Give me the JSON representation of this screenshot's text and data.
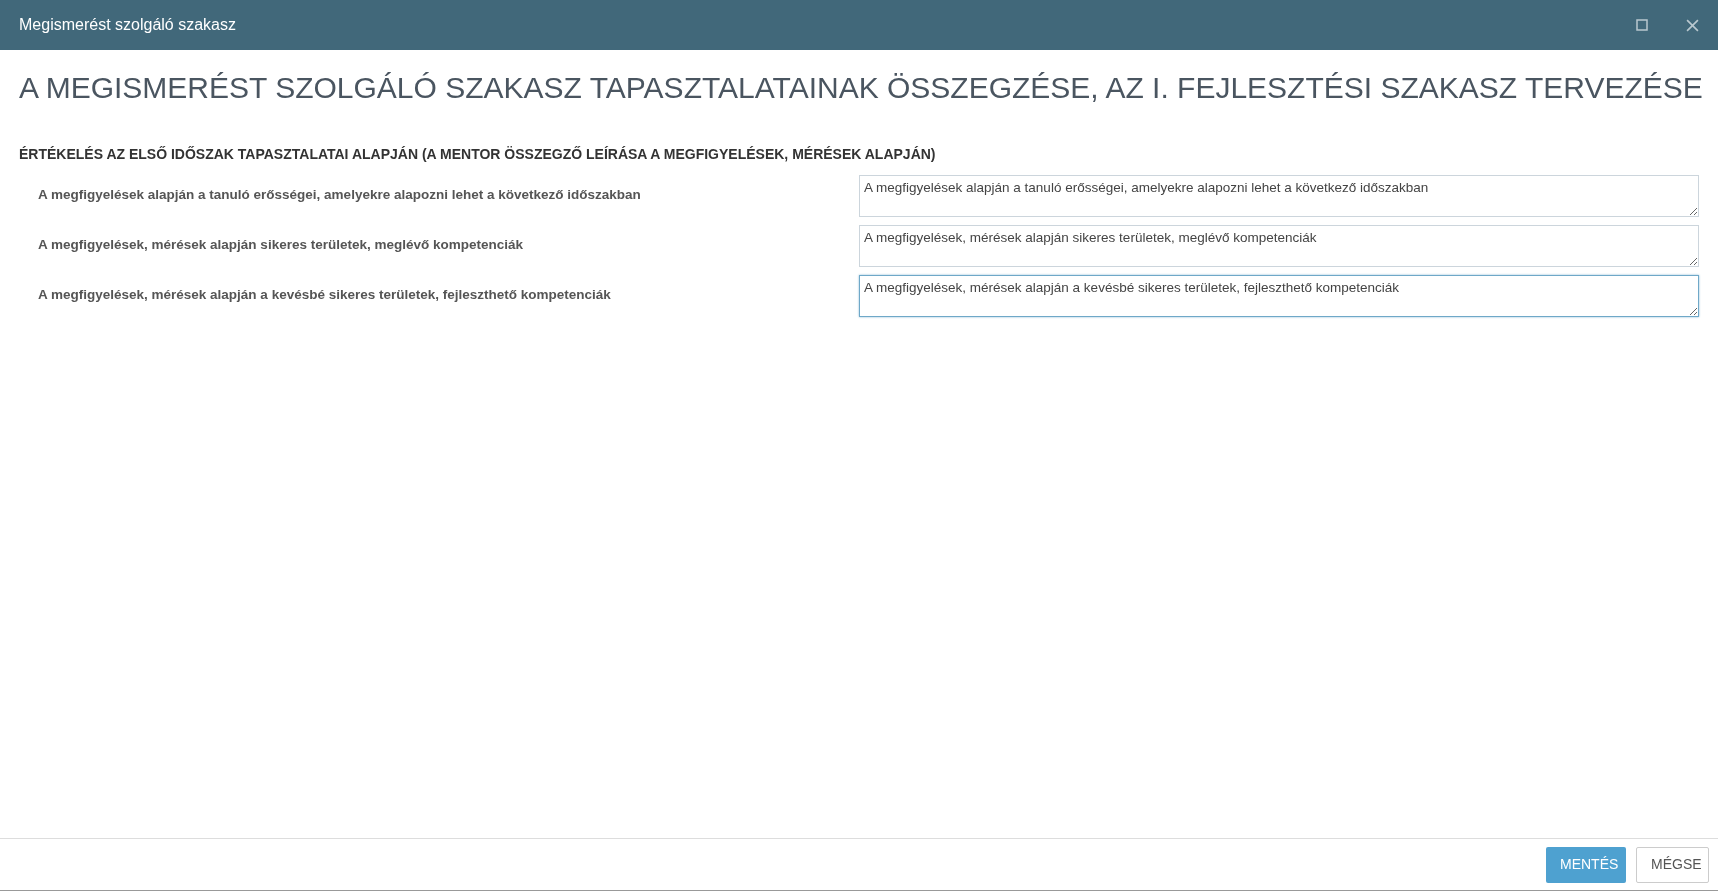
{
  "window": {
    "title": "Megismerést szolgáló szakasz"
  },
  "page_title": "A MEGISMERÉST SZOLGÁLÓ SZAKASZ TAPASZTALATAINAK ÖSSZEGZÉSE, AZ I. FEJLESZTÉSI SZAKASZ TERVEZÉSE",
  "section": {
    "heading": "ÉRTÉKELÉS AZ ELSŐ IDŐSZAK TAPASZTALATAI ALAPJÁN (A MENTOR ÖSSZEGZŐ LEÍRÁSA A MEGFIGYELÉSEK, MÉRÉSEK ALAPJÁN)",
    "fields": [
      {
        "label": "A megfigyelések alapján a tanuló erősségei, amelyekre alapozni lehet a következő időszakban",
        "value": "A megfigyelések alapján a tanuló erősségei, amelyekre alapozni lehet a következő időszakban",
        "focused": false
      },
      {
        "label": "A megfigyelések, mérések alapján sikeres területek, meglévő kompetenciák",
        "value": "A megfigyelések, mérések alapján sikeres területek, meglévő kompetenciák",
        "focused": false
      },
      {
        "label": "A megfigyelések, mérések alapján a kevésbé sikeres területek, fejleszthető kompetenciák",
        "value": "A megfigyelések, mérések alapján a kevésbé sikeres területek, fejleszthető kompetenciák",
        "focused": true
      }
    ]
  },
  "buttons": [
    {
      "label": "MENTÉS",
      "kind": "primary"
    },
    {
      "label": "MÉGSE",
      "kind": "secondary"
    }
  ]
}
